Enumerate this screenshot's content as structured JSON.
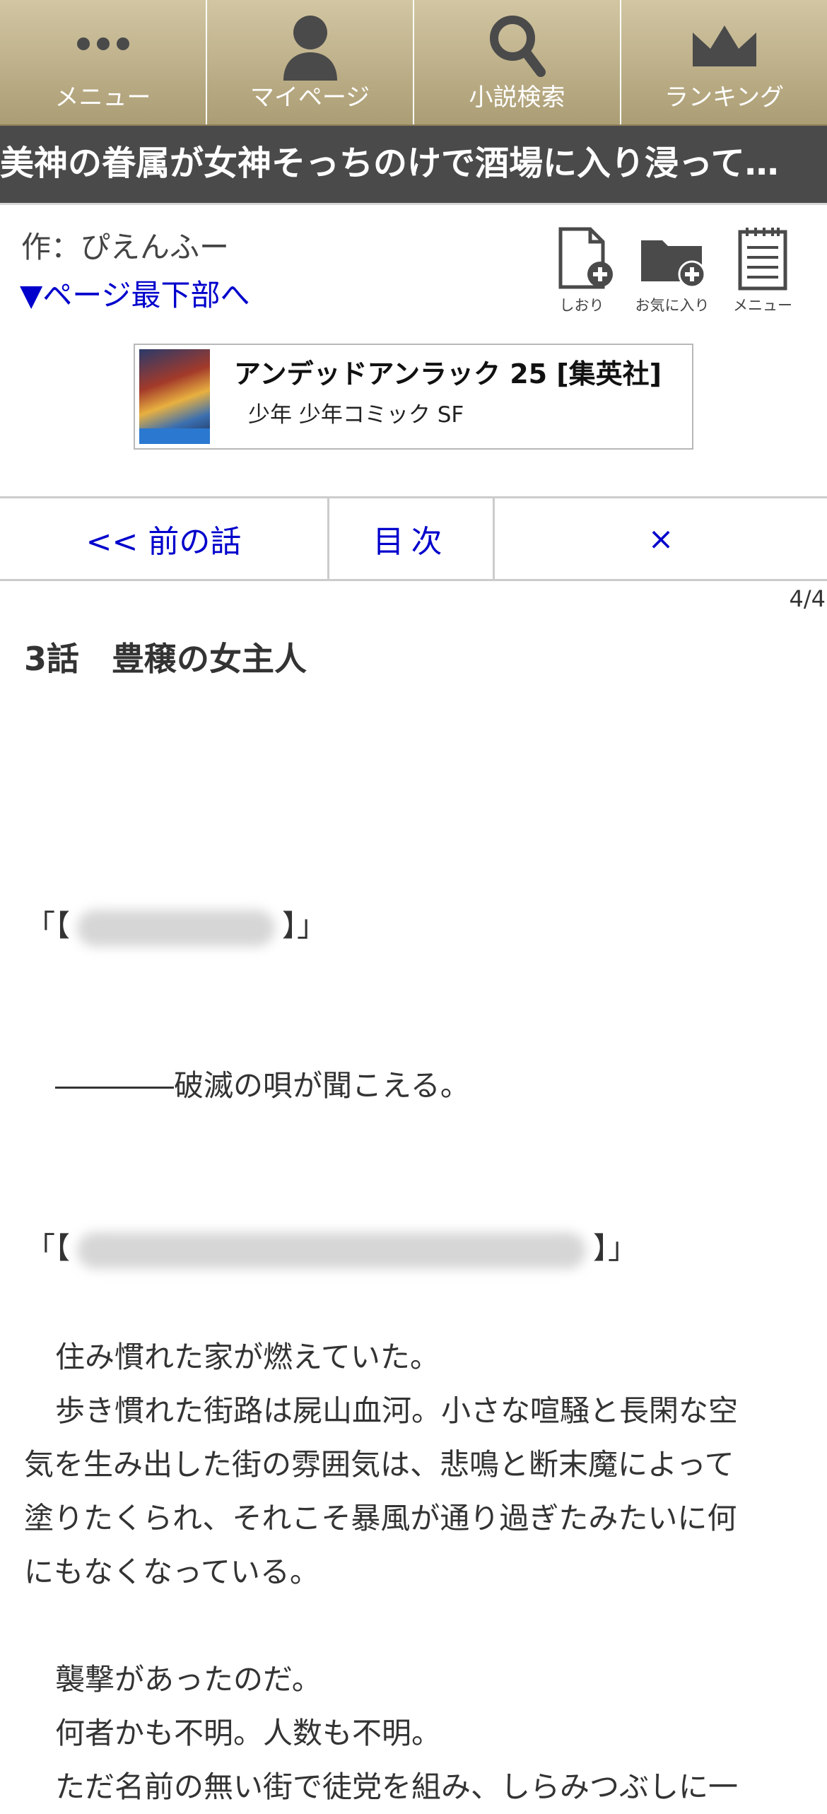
{
  "nav": {
    "items": [
      {
        "label": "メニュー",
        "icon": "dots-menu-icon"
      },
      {
        "label": "マイページ",
        "icon": "user-icon"
      },
      {
        "label": "小説検索",
        "icon": "search-icon"
      },
      {
        "label": "ランキング",
        "icon": "crown-icon"
      }
    ]
  },
  "novel": {
    "title": "美神の眷属が女神そっちのけで酒場に入り浸ってる件について"
  },
  "author": {
    "line": "作：ぴえんふー",
    "jump_bottom": "▼ページ最下部へ"
  },
  "tools": {
    "bookmark": "しおり",
    "favorite": "お気に入り",
    "menu": "メニュー"
  },
  "ad": {
    "title": "アンデッドアンラック 25 [集英社]",
    "subtitle": "少年 少年コミック SF"
  },
  "pager": {
    "prev": "<< 前の話",
    "toc": "目次",
    "close": "×"
  },
  "page_count": "4/4",
  "chapter": {
    "title": "3話　豊穣の女主人",
    "spell_open": "「【",
    "spell_close": "】」",
    "doom_line": "――――破滅の唄が聞こえる。",
    "paragraphs": [
      "住み慣れた家が燃えていた。",
      "歩き慣れた街路は屍山血河。小さな喧騒と長閑な空",
      "気を生み出した街の雰囲気は、悲鳴と断末魔によって",
      "塗りたくられ、それこそ暴風が通り過ぎたみたいに何",
      "にもなくなっている。",
      "襲撃があったのだ。",
      "何者かも不明。人数も不明。",
      "ただ名前の無い街で徒党を組み、しらみつぶしに一"
    ]
  },
  "colors": {
    "nav_gradient_top": "#d2c6a3",
    "nav_gradient_bottom": "#ab9d74",
    "title_bar": "#4a4a4a",
    "link": "#0000cc"
  }
}
